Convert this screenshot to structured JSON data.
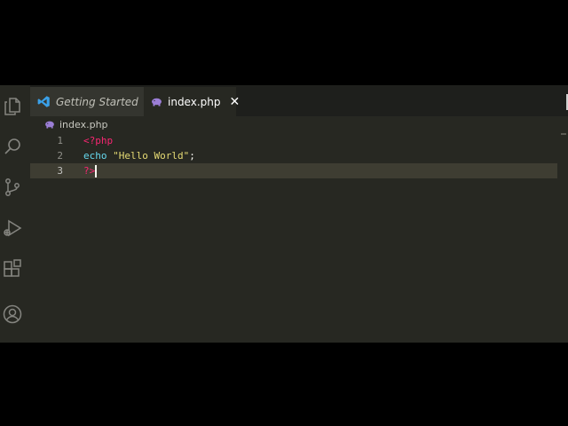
{
  "tabs": [
    {
      "label": "Getting Started",
      "icon": "vscode-logo-icon",
      "active": false
    },
    {
      "label": "index.php",
      "icon": "php-elephant-icon",
      "active": true,
      "close_glyph": "✕"
    }
  ],
  "breadcrumb": {
    "file": "index.php",
    "icon": "php-elephant-icon"
  },
  "activity_bar": [
    "explorer-icon",
    "search-icon",
    "source-control-icon",
    "run-debug-icon",
    "extensions-icon",
    "account-icon"
  ],
  "editor": {
    "lines": [
      {
        "number": "1",
        "open_tag": "<?php"
      },
      {
        "number": "2",
        "keyword": "echo",
        "space": " ",
        "string": "\"Hello World\"",
        "semicolon": ";"
      },
      {
        "number": "3",
        "close_tag": "?>"
      }
    ],
    "current_line": 3
  },
  "colors": {
    "background": "#272822",
    "tag": "#f92672",
    "keyword": "#66d9ef",
    "string": "#e6db74",
    "vscode_blue": "#3aa0e8",
    "php_purple": "#9b7ed6"
  }
}
